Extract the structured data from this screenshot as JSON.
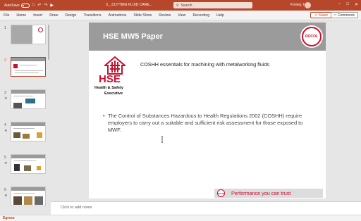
{
  "titlebar": {
    "autosave_label": "AutoSave",
    "toggle_state": "Off",
    "filename": "3__CUTTING FLUID CARE...",
    "search_placeholder": "Search",
    "user_name": "Forney, Ian"
  },
  "ribbon": {
    "tabs": [
      "File",
      "Home",
      "Insert",
      "Draw",
      "Design",
      "Transitions",
      "Animations",
      "Slide Show",
      "Review",
      "View",
      "Recording",
      "Help"
    ],
    "share_label": "Share",
    "comments_label": "Comments"
  },
  "thumbnails": {
    "numbers": [
      "1",
      "2",
      "3",
      "4",
      "5",
      "6"
    ],
    "active_index": 1
  },
  "slide": {
    "title": "HSE MW5 Paper",
    "logo_text": "ROCOL",
    "hse_logo": {
      "letters": "HSE",
      "line1": "Health & Safety",
      "line2": "Executive"
    },
    "subtitle": "COSHH essentials for machining with metalworking fluids",
    "bullet": "The Control of Substances Hazardous to Health Regulations 2002 (COSHH) require employers to carry out a suitable and sufficient risk assessment for those exposed to MWF.",
    "footer_logo": "ROCOL",
    "footer_tagline": "Performance you can trust"
  },
  "notes": {
    "placeholder": "Click to add notes"
  },
  "statusbar": {
    "text": "Egress"
  },
  "colors": {
    "accent": "#b7472a",
    "brand_red": "#c8102e",
    "slide_header": "#9b9b9b"
  }
}
